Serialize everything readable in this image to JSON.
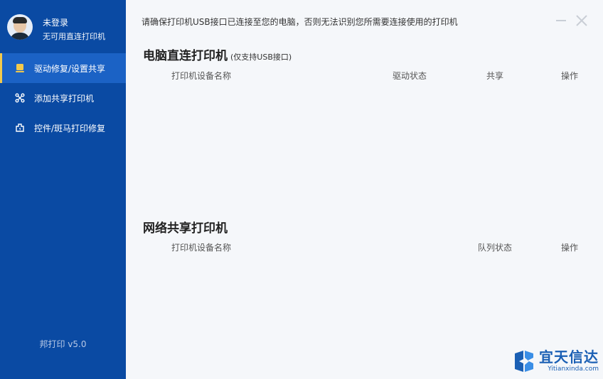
{
  "user": {
    "name": "未登录",
    "subtitle": "无可用直连打印机"
  },
  "nav": [
    {
      "label": "驱动修复/设置共享",
      "icon": "driver-icon"
    },
    {
      "label": "添加共享打印机",
      "icon": "network-icon"
    },
    {
      "label": "控件/斑马打印修复",
      "icon": "repair-icon"
    }
  ],
  "version": "邦打印 v5.0",
  "notice": "请确保打印机USB接口已连接至您的电脑，否则无法识别您所需要连接使用的打印机",
  "direct": {
    "title": "电脑直连打印机",
    "subtitle": "(仅支持USB接口)",
    "columns": [
      "打印机设备名称",
      "驱动状态",
      "共享",
      "操作"
    ]
  },
  "shared": {
    "title": "网络共享打印机",
    "columns": [
      "打印机设备名称",
      "队列状态",
      "操作"
    ]
  },
  "watermark": {
    "title": "宜天信达",
    "url": "Yitianxinda.com"
  },
  "colors": {
    "sidebar": "#0a4aa3",
    "active": "#1b62c5",
    "accent": "#f2c94c",
    "main_bg": "#f5f7fa"
  }
}
